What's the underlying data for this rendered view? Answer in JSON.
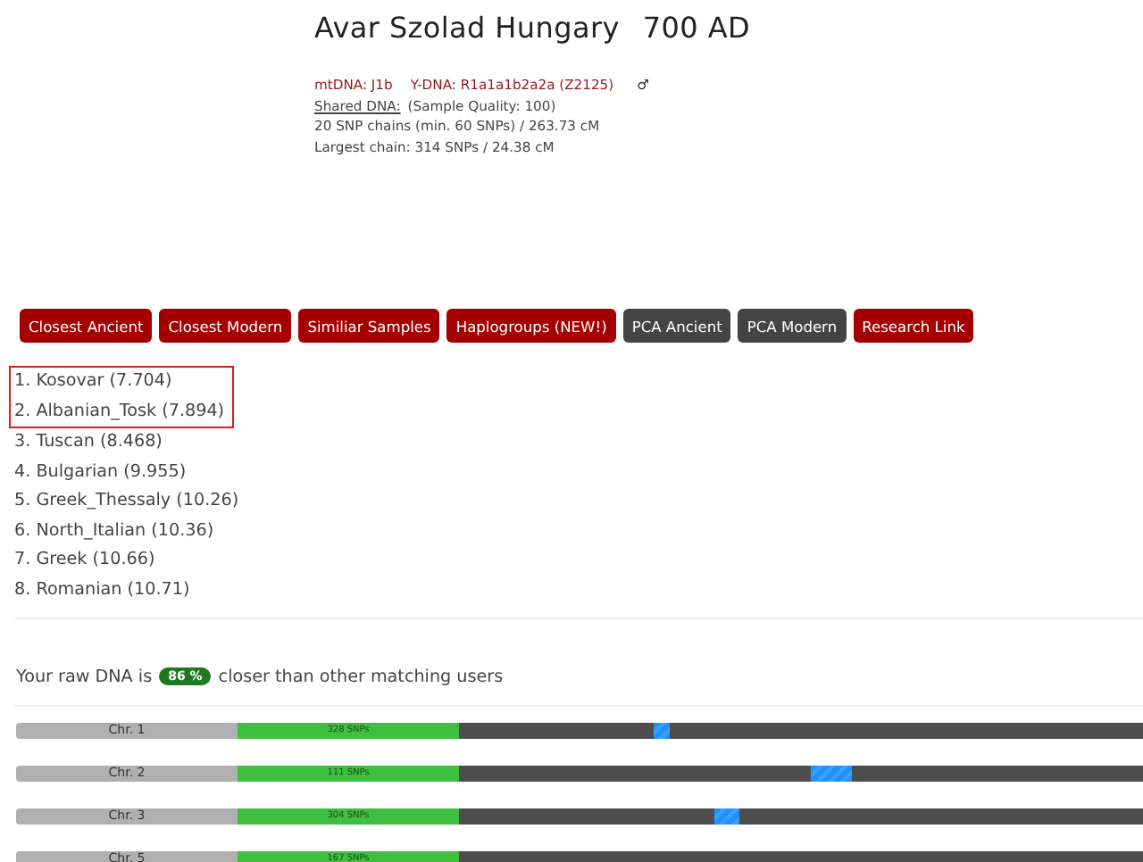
{
  "header": {
    "title": "Avar Szolad Hungary",
    "date": "700 AD",
    "mtdna": "mtDNA: J1b",
    "ydna": "Y-DNA: R1a1a1b2a2a (Z2125)",
    "sex_symbol": "♂",
    "shared_link": "Shared DNA:",
    "quality": "(Sample Quality: 100)",
    "chains": "20 SNP chains (min. 60 SNPs) / 263.73 cM",
    "largest": "Largest chain: 314 SNPs / 24.38 cM"
  },
  "buttons": [
    {
      "label": "Closest Ancient",
      "kind": "primary"
    },
    {
      "label": "Closest Modern",
      "kind": "primary"
    },
    {
      "label": "Similiar Samples",
      "kind": "primary"
    },
    {
      "label": "Haplogroups (NEW!)",
      "kind": "primary"
    },
    {
      "label": "PCA Ancient",
      "kind": "secondary"
    },
    {
      "label": "PCA Modern",
      "kind": "secondary"
    },
    {
      "label": "Research Link",
      "kind": "primary"
    }
  ],
  "results": [
    {
      "text": "1. Kosovar (7.704)",
      "highlighted": true
    },
    {
      "text": "2. Albanian_Tosk (7.894)",
      "highlighted": true
    },
    {
      "text": "3. Tuscan (8.468)",
      "highlighted": false
    },
    {
      "text": "4. Bulgarian (9.955)",
      "highlighted": false
    },
    {
      "text": "5. Greek_Thessaly (10.26)",
      "highlighted": false
    },
    {
      "text": "6. North_Italian (10.36)",
      "highlighted": false
    },
    {
      "text": "7. Greek (10.66)",
      "highlighted": false
    },
    {
      "text": "8. Romanian (10.71)",
      "highlighted": false
    }
  ],
  "comparison": {
    "before": "Your raw DNA is",
    "badge": "86 %",
    "after": "closer than other matching users"
  },
  "chromosomes": [
    {
      "label": "Chr. 1",
      "snps": "328 SNPs"
    },
    {
      "label": "Chr. 2",
      "snps": "111 SNPs"
    },
    {
      "label": "Chr. 3",
      "snps": "304 SNPs"
    },
    {
      "label": "Chr. 5",
      "snps": "167 SNPs"
    }
  ]
}
